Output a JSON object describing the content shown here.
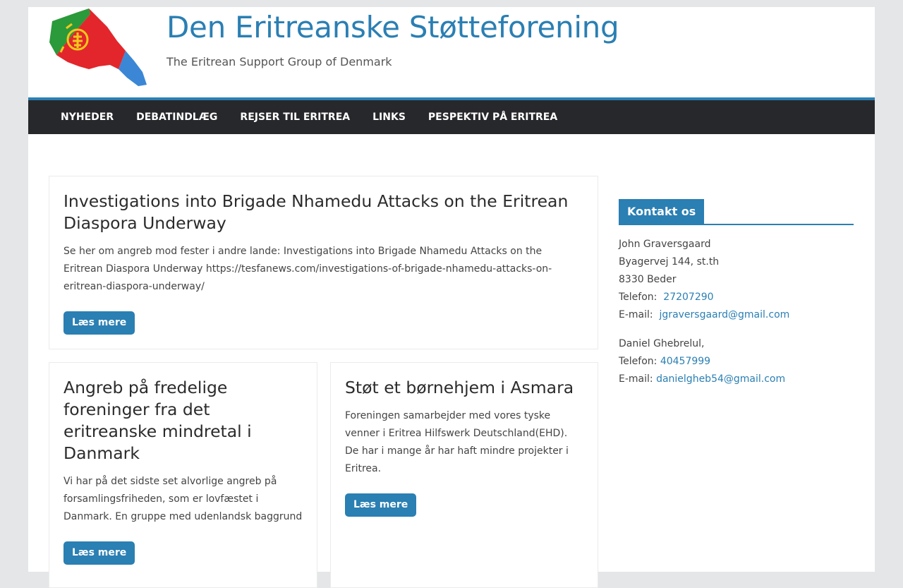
{
  "site": {
    "title": "Den Eritreanske Støtteforening",
    "description": "The Eritrean Support Group of Denmark"
  },
  "nav": {
    "items": [
      "NYHEDER",
      "DEBATINDLÆG",
      "REJSER TIL ERITREA",
      "LINKS",
      "PESPEKTIV PÅ ERITREA"
    ]
  },
  "posts": [
    {
      "title": "Investigations into Brigade Nhamedu Attacks on the Eritrean Diaspora Underway",
      "excerpt": "Se her om angreb mod fester i andre lande: Investigations into Brigade Nhamedu Attacks on the Eritrean Diaspora Underway https://tesfanews.com/investigations-of-brigade-nhamedu-attacks-on-eritrean-diaspora-underway/",
      "button": "Læs mere"
    },
    {
      "title": "Angreb på fredelige foreninger fra det eritreanske mindretal i Danmark",
      "excerpt": "Vi har på det sidste set alvorlige angreb på forsamlingsfriheden, som er lovfæstet i Danmark. En gruppe med udenlandsk baggrund",
      "button": "Læs mere"
    },
    {
      "title": "Støt et børnehjem i Asmara",
      "excerpt": "Foreningen samarbejder med vores tyske venner i Eritrea Hilfswerk Deutschland(EHD). De har i mange år har haft mindre projekter i Eritrea.",
      "button": "Læs mere"
    }
  ],
  "sidebar": {
    "title": "Kontakt os",
    "contact1": {
      "name": "John Graversgaard",
      "address": "Byagervej 144, st.th",
      "city": "8330 Beder",
      "phone_label": "Telefon:",
      "phone": "27207290",
      "email_label": "E-mail:",
      "email": "jgraversgaard@gmail.com"
    },
    "contact2": {
      "name": "Daniel Ghebrelul,",
      "phone_label": "Telefon:",
      "phone": "40457999",
      "email_label": "E-mail:",
      "email": "danielgheb54@gmail.com"
    }
  },
  "colors": {
    "accent": "#2a7fb3",
    "nav_bg": "#27282b",
    "page_bg": "#e5e6e8"
  },
  "icons": {
    "logo": "eritrea-map-flag-logo"
  }
}
